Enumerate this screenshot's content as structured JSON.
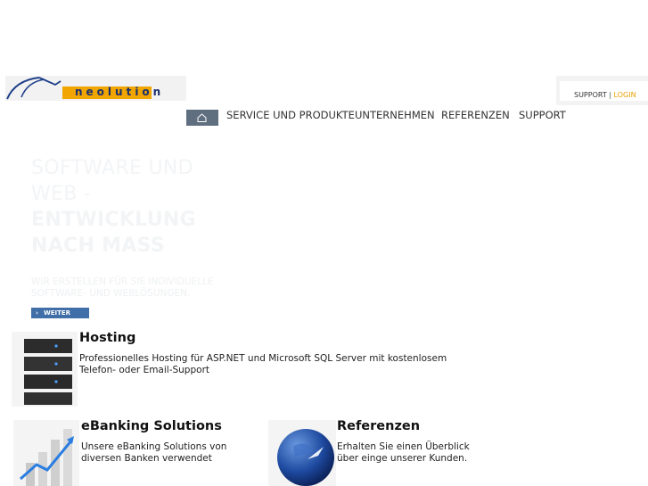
{
  "logo": {
    "text": "neolution"
  },
  "auth": {
    "support": "SUPPORT",
    "separator": "|",
    "login": "LOGIN"
  },
  "nav": {
    "home_icon": "home-icon",
    "items": [
      {
        "label": "SERVICE UND PRODUKTE"
      },
      {
        "label": "UNTERNEHMEN"
      },
      {
        "label": "REFERENZEN"
      },
      {
        "label": "SUPPORT"
      }
    ]
  },
  "hero": {
    "title_line1": "SOFTWARE UND",
    "title_line2": "WEB -",
    "title_bold1": "ENTWICKLUNG",
    "title_bold2": "NACH MASS",
    "subtitle": "WIR ERSTELLEN FÜR SIE INDIVIDUELLE SOFTWARE- UND WEBLÖSUNGEN.",
    "button": "WEITER"
  },
  "blocks": {
    "hosting": {
      "title": "Hosting",
      "text": "Professionelles Hosting für ASP.NET und Microsoft SQL Server mit kostenlosem Telefon- oder Email-Support"
    },
    "ebanking": {
      "title": "eBanking Solutions",
      "text": "Unsere eBanking Solutions von diversen Banken verwendet"
    },
    "referenzen": {
      "title": "Referenzen",
      "text": "Erhalten Sie einen Überblick über einge unserer Kunden."
    }
  },
  "colors": {
    "nav_home_bg": "#5f6f80",
    "accent_orange": "#f0a500",
    "button_blue": "#3f6ea8"
  }
}
